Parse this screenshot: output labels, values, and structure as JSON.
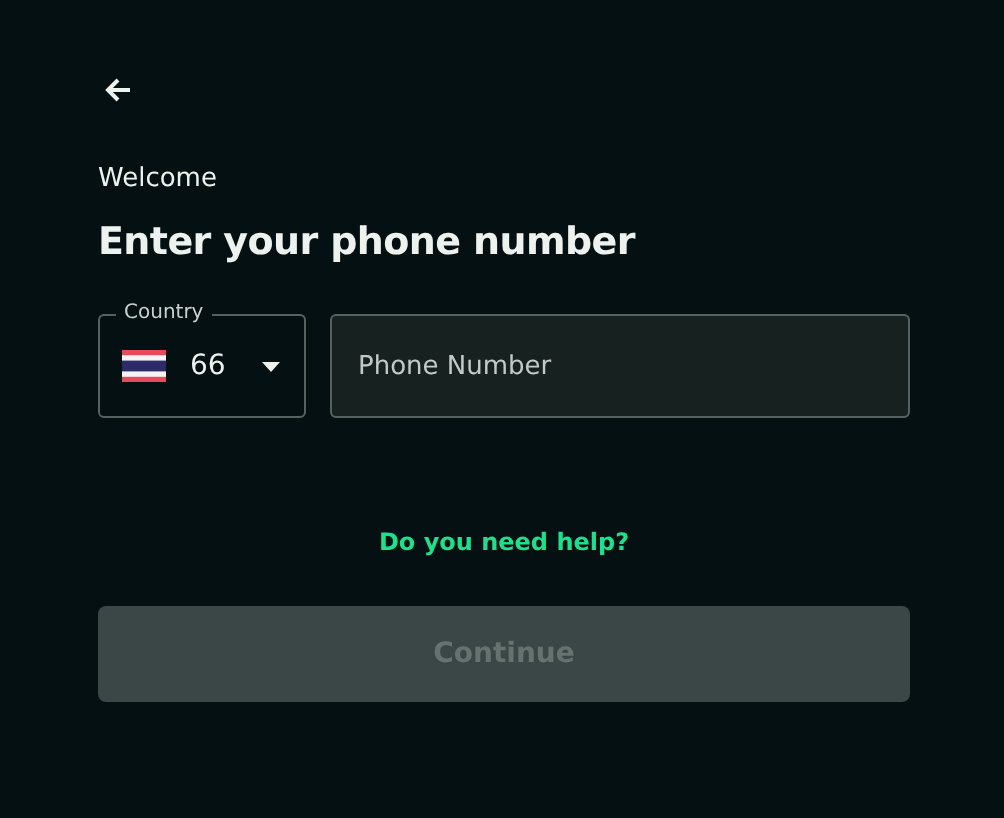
{
  "greeting": "Welcome",
  "title": "Enter your phone number",
  "country": {
    "label": "Country",
    "code": "66"
  },
  "phone": {
    "placeholder": "Phone Number"
  },
  "help_link": "Do you need help?",
  "continue_button": {
    "label": "Continue",
    "disabled": true
  }
}
